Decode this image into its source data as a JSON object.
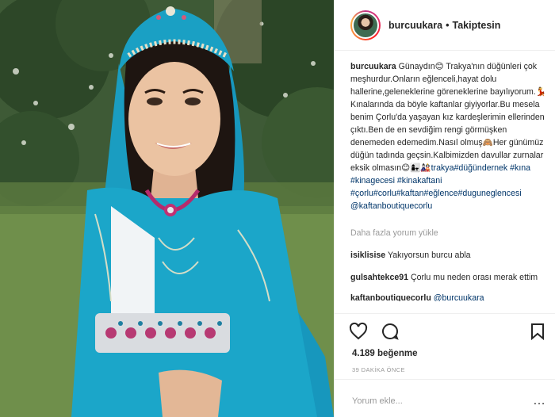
{
  "post": {
    "username": "burcuukara",
    "follow_status": "Takiptesin",
    "separator": "•",
    "avatar_icon": "profile-avatar",
    "caption": [
      {
        "type": "user",
        "text": "burcuukara"
      },
      {
        "type": "text",
        "text": " Günaydın😊 Trakya'nın düğünleri çok meşhurdur.Onların eğlenceli,hayat dolu hallerine,geleneklerine göreneklerine bayılıyorum.💃Kınalarında da böyle kaftanlar giyiyorlar.Bu mesela benim Çorlu'da yaşayan kız kardeşlerimin ellerinden çıktı.Ben de en sevdiğim rengi görmüşken denemeden edemedim.Nasıl olmuş🙈Her günümüz düğün tadında geçsin.Kalbimizden davullar zurnalar eksik olmasın😊👩‍👧🎎"
      },
      {
        "type": "tag",
        "text": "trakya"
      },
      {
        "type": "tag",
        "text": "#düğündernek"
      },
      {
        "type": "tag",
        "text": " #kına"
      },
      {
        "type": "tag",
        "text": " #kinagecesi"
      },
      {
        "type": "tag",
        "text": " #kinakaftani"
      },
      {
        "type": "tag",
        "text": " #çorlu"
      },
      {
        "type": "tag",
        "text": "#corlu"
      },
      {
        "type": "tag",
        "text": "#kaftan"
      },
      {
        "type": "tag",
        "text": "#eğlence"
      },
      {
        "type": "tag",
        "text": "#duguneglencesi"
      },
      {
        "type": "tag",
        "text": " @kaftanboutiquecorlu"
      }
    ],
    "load_more_comments": "Daha fazla yorum yükle",
    "comments": [
      {
        "user": "isiklisise",
        "text": "Yakıyorsun burcu abla"
      },
      {
        "user": "gulsahtekce91",
        "text": "Çorlu mu neden orası merak ettim"
      },
      {
        "user": "kaftanboutiquecorlu",
        "text": "@burcuukara",
        "is_tag": true
      }
    ],
    "action_icons": [
      "heart-icon",
      "comment-icon",
      "bookmark-icon"
    ],
    "likes": "4.189 beğenme",
    "time_ago": "39 DAKİKA ÖNCE",
    "add_comment_placeholder": "Yorum ekle...",
    "more_icon": "…"
  },
  "colors": {
    "link": "#003569",
    "muted": "#999999",
    "text": "#262626",
    "border": "#efefef",
    "kaftan": "#1aa0c4"
  }
}
